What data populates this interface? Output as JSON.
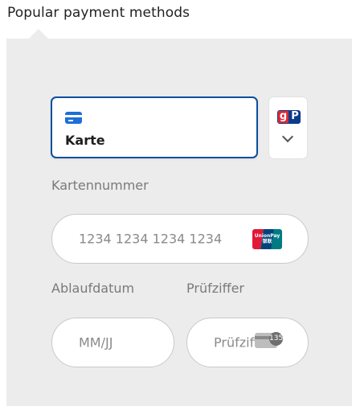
{
  "heading": "Popular payment methods",
  "tabs": [
    {
      "label": "Karte",
      "icon": "credit-card-icon",
      "selected": true
    },
    {
      "label": "",
      "icon": "giropay-logo-icon",
      "selected": false
    }
  ],
  "fields": {
    "card_number": {
      "label": "Kartennummer",
      "placeholder": "1234 1234 1234 1234",
      "brand_icon": "unionpay-logo-icon",
      "brand_text": "UnionPay 银联"
    },
    "expiry": {
      "label": "Ablaufdatum",
      "placeholder": "MM/JJ"
    },
    "cvc": {
      "label": "Prüfziffer",
      "placeholder": "Prüfziffer",
      "icon": "cvc-card-icon",
      "badge": "135"
    }
  },
  "logos": {
    "giropay_g": "g",
    "giropay_p": "P"
  },
  "colors": {
    "accent": "#0b4f9e",
    "panel": "#ececec",
    "card_icon": "#1b6fd8"
  }
}
